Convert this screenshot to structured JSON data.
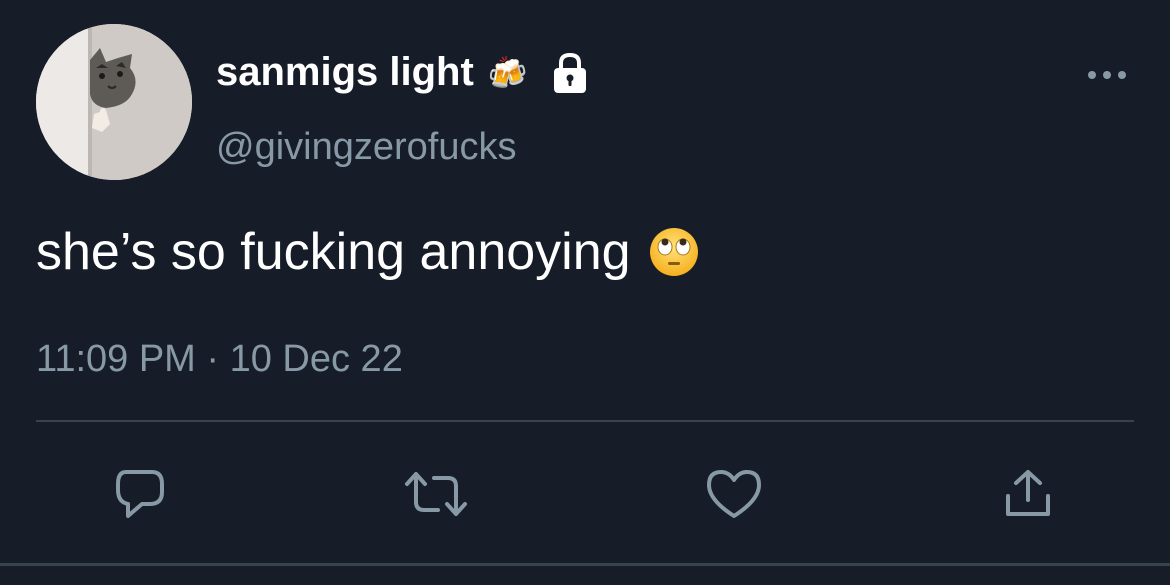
{
  "tweet": {
    "display_name": "sanmigs light",
    "name_emoji": "🍻",
    "handle": "@givingzerofucks",
    "text": "she’s so fucking annoying",
    "timestamp": "11:09 PM · 10 Dec 22"
  },
  "icons": {
    "avatar": "cat-peeking-photo",
    "name_badge": "beer-mugs-icon",
    "protected": "lock-icon",
    "more": "more-horizontal-icon",
    "text_emoji": "rolling-eyes-emoji-icon",
    "actions": [
      "reply-icon",
      "retweet-icon",
      "like-icon",
      "share-icon"
    ]
  },
  "colors": {
    "background": "#161d28",
    "primary_text": "#ffffff",
    "secondary_text": "#8899a6",
    "divider": "#38444d"
  }
}
